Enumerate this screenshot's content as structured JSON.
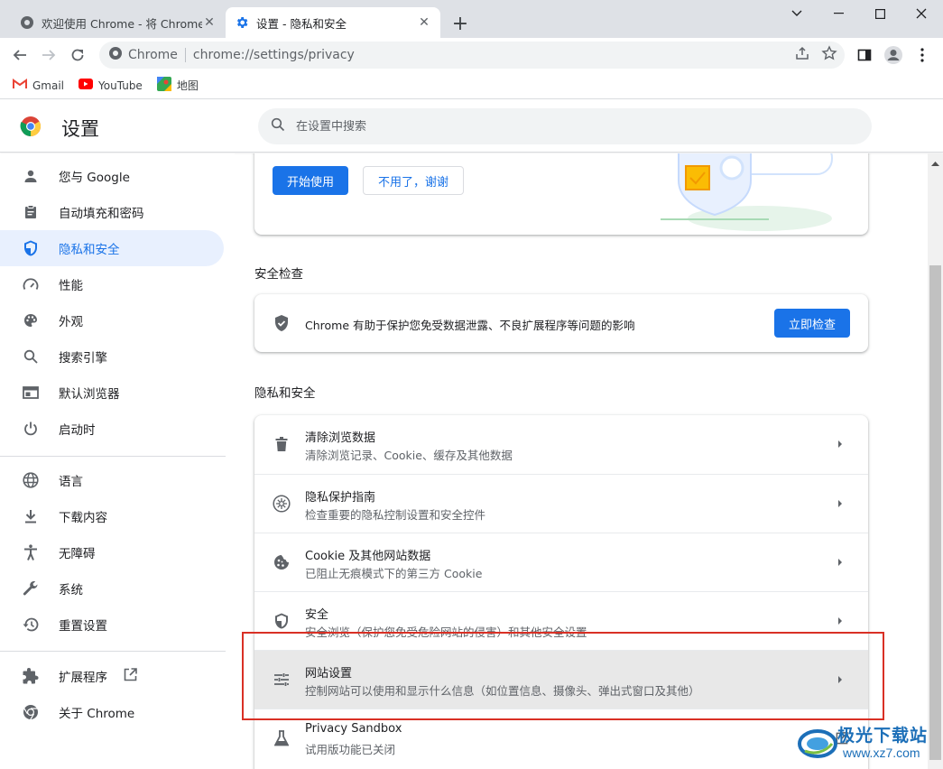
{
  "browser": {
    "tabs": [
      {
        "title": "欢迎使用 Chrome - 将 Chrome",
        "active": false
      },
      {
        "title": "设置 - 隐私和安全",
        "active": true
      }
    ],
    "address": {
      "site_label": "Chrome",
      "url": "chrome://settings/privacy"
    },
    "bookmarks": [
      {
        "label": "Gmail",
        "icon": "gmail-icon"
      },
      {
        "label": "YouTube",
        "icon": "youtube-icon"
      },
      {
        "label": "地图",
        "icon": "maps-icon"
      }
    ]
  },
  "header": {
    "title": "设置",
    "search_placeholder": "在设置中搜索"
  },
  "sidebar": {
    "items": [
      {
        "label": "您与 Google",
        "icon": "person-icon",
        "selected": false
      },
      {
        "label": "自动填充和密码",
        "icon": "clipboard-icon",
        "selected": false
      },
      {
        "label": "隐私和安全",
        "icon": "shield-icon",
        "selected": true
      },
      {
        "label": "性能",
        "icon": "speedometer-icon",
        "selected": false
      },
      {
        "label": "外观",
        "icon": "palette-icon",
        "selected": false
      },
      {
        "label": "搜索引擎",
        "icon": "search-icon",
        "selected": false
      },
      {
        "label": "默认浏览器",
        "icon": "browser-icon",
        "selected": false
      },
      {
        "label": "启动时",
        "icon": "power-icon",
        "selected": false
      },
      {
        "label": "语言",
        "icon": "globe-icon",
        "selected": false
      },
      {
        "label": "下载内容",
        "icon": "download-icon",
        "selected": false
      },
      {
        "label": "无障碍",
        "icon": "accessibility-icon",
        "selected": false
      },
      {
        "label": "系统",
        "icon": "wrench-icon",
        "selected": false
      },
      {
        "label": "重置设置",
        "icon": "history-icon",
        "selected": false
      },
      {
        "label": "扩展程序",
        "icon": "puzzle-icon",
        "selected": false
      },
      {
        "label": "关于 Chrome",
        "icon": "chrome-icon",
        "selected": false
      }
    ]
  },
  "promo": {
    "start_button": "开始使用",
    "decline_button": "不用了，谢谢"
  },
  "safety_check": {
    "section_title": "安全检查",
    "description": "Chrome 有助于保护您免受数据泄露、不良扩展程序等问题的影响",
    "button": "立即检查"
  },
  "privacy": {
    "section_title": "隐私和安全",
    "rows": [
      {
        "title": "清除浏览数据",
        "subtitle": "清除浏览记录、Cookie、缓存及其他数据",
        "icon": "trash-icon"
      },
      {
        "title": "隐私保护指南",
        "subtitle": "检查重要的隐私控制设置和安全控件",
        "icon": "compass-icon"
      },
      {
        "title": "Cookie 及其他网站数据",
        "subtitle": "已阻止无痕模式下的第三方 Cookie",
        "icon": "cookie-icon"
      },
      {
        "title": "安全",
        "subtitle": "安全浏览（保护您免受危险网站的侵害）和其他安全设置",
        "icon": "security-shield-icon"
      },
      {
        "title": "网站设置",
        "subtitle": "控制网站可以使用和显示什么信息（如位置信息、摄像头、弹出式窗口及其他）",
        "icon": "tune-icon",
        "highlighted": true
      },
      {
        "title": "Privacy Sandbox",
        "subtitle": "试用版功能已关闭",
        "icon": "flask-icon"
      }
    ]
  },
  "watermark": {
    "brand": "极光下载站",
    "url": "www.xz7.com"
  },
  "colors": {
    "accent": "#1a73e8",
    "selected_bg": "#e8f0fe",
    "annotation_red": "#d93025"
  }
}
